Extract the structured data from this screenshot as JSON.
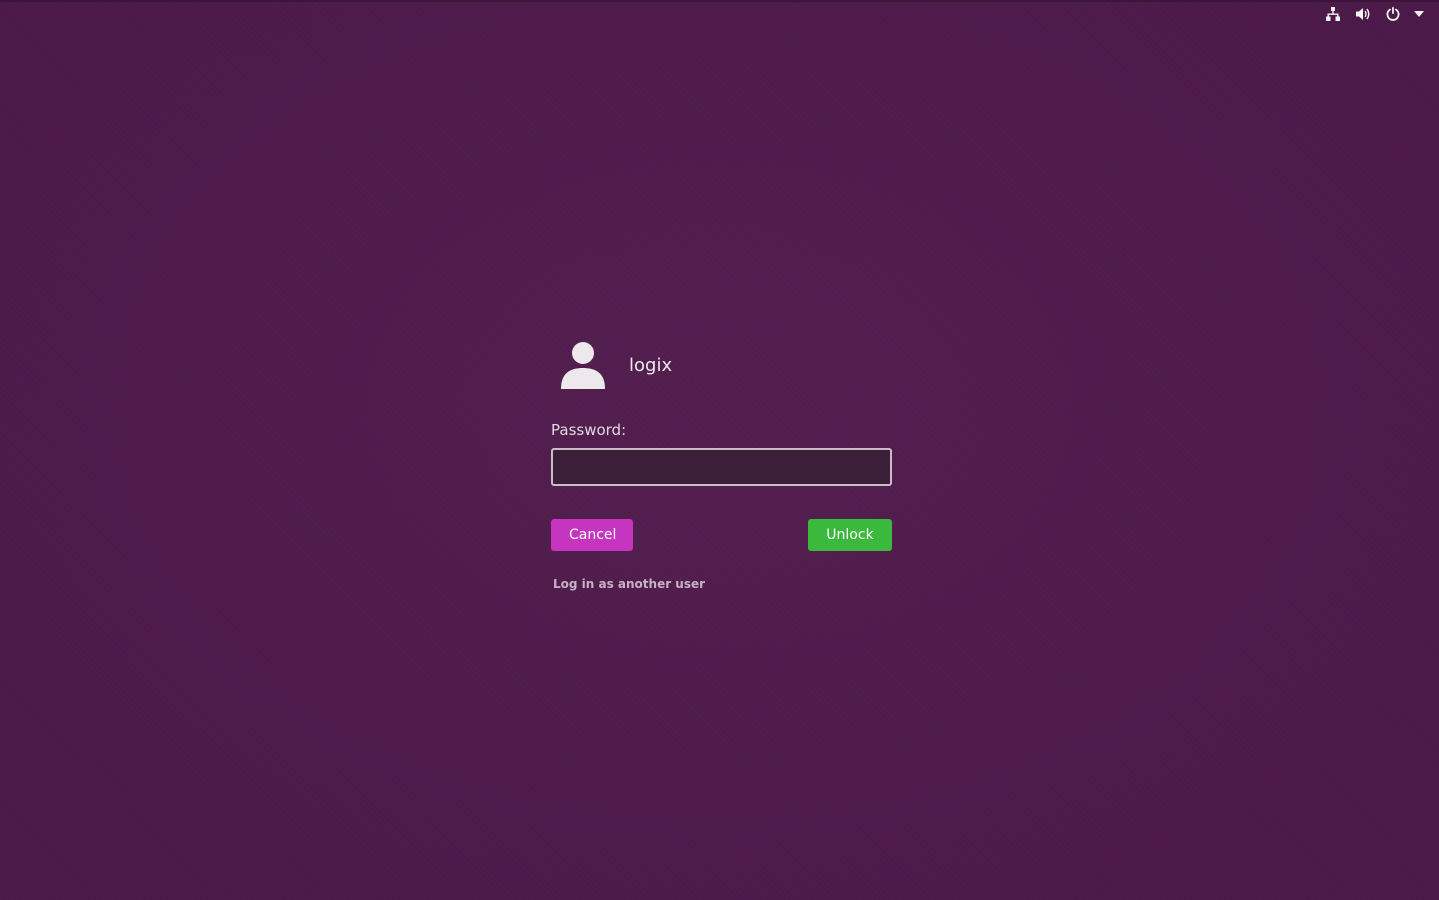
{
  "indicators": {
    "network": "network-icon",
    "sound": "volume-icon",
    "power": "power-icon",
    "menu": "chevron-down-icon"
  },
  "user": {
    "avatar_icon": "user-avatar-icon",
    "name": "logix"
  },
  "password": {
    "label": "Password:",
    "value": "",
    "placeholder": ""
  },
  "buttons": {
    "cancel_label": "Cancel",
    "unlock_label": "Unlock"
  },
  "other_user_link": "Log in as another user",
  "colors": {
    "background": "#4f1a4c",
    "cancel": "#c535c0",
    "unlock": "#3bb93c"
  }
}
